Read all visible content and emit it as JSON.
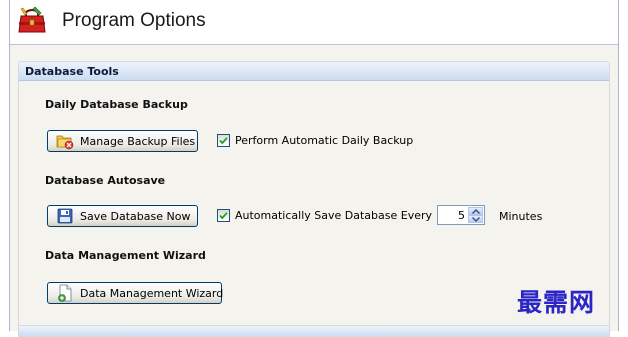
{
  "header": {
    "title": "Program Options",
    "icon": "toolbox-icon"
  },
  "group": {
    "title": "Database Tools"
  },
  "backup": {
    "section_title": "Daily Database Backup",
    "button_label": "Manage Backup Files",
    "button_icon": "folder-delete-icon",
    "checkbox_label": "Perform Automatic Daily Backup",
    "checkbox_checked": true
  },
  "autosave": {
    "section_title": "Database Autosave",
    "button_label": "Save Database Now",
    "button_icon": "floppy-disk-icon",
    "checkbox_label": "Automatically Save Database Every",
    "checkbox_checked": true,
    "interval_value": "5",
    "interval_unit": "Minutes"
  },
  "wizard": {
    "section_title": "Data Management Wizard",
    "button_label": "Data Management Wizard",
    "button_icon": "new-document-icon"
  },
  "watermark": "最需网",
  "colors": {
    "group_header": "#cddcf2",
    "panel_bg": "#f4f3ee",
    "button_border": "#003c74",
    "check_mark": "#21a121",
    "watermark": "#2b24c7"
  }
}
